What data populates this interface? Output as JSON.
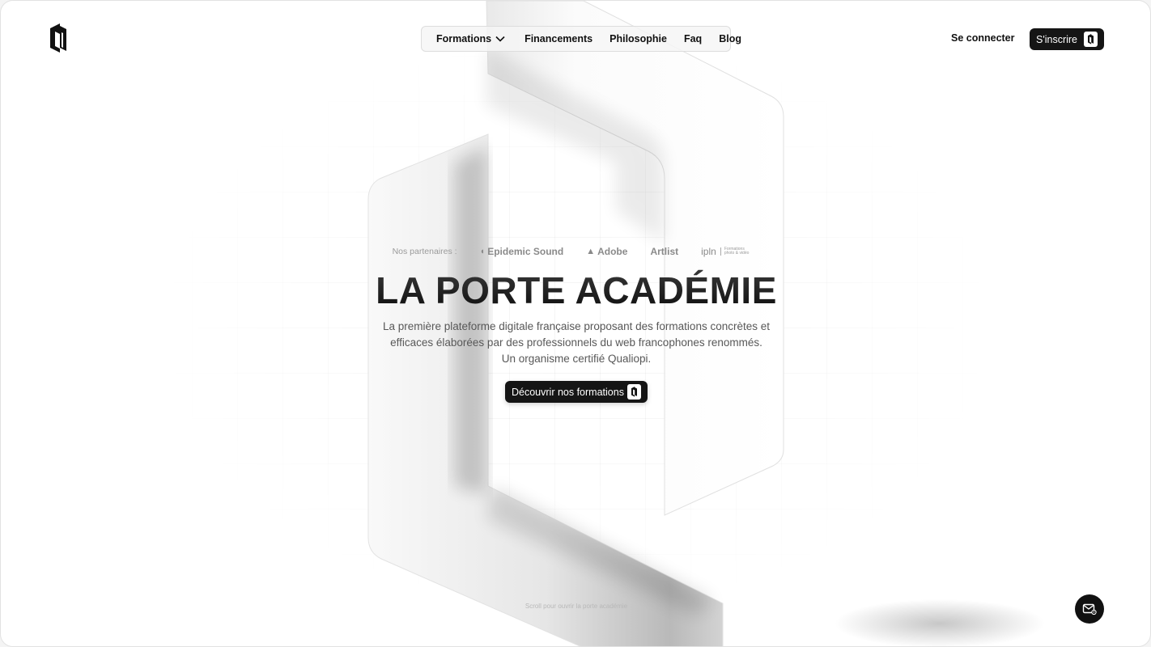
{
  "nav": {
    "items": [
      {
        "label": "Formations",
        "has_dropdown": true
      },
      {
        "label": "Financements"
      },
      {
        "label": "Philosophie"
      },
      {
        "label": "Faq"
      },
      {
        "label": "Blog"
      }
    ]
  },
  "auth": {
    "login_label": "Se connecter",
    "signup_label": "S'inscrire"
  },
  "hero": {
    "partners_label": "Nos partenaires :",
    "partners": [
      "Epidemic Sound",
      "Adobe",
      "Artlist",
      "ipln"
    ],
    "partners_extra": [
      "Formations",
      "photo & vidéo"
    ],
    "title": "LA PORTE ACADÉMIE",
    "subtitle_lines": [
      "La première plateforme digitale française proposant des formations concrètes et",
      "efficaces élaborées par des professionnels du web francophones renommés.",
      "Un organisme certifié Qualiopi."
    ],
    "cta_label": "Découvrir nos formations",
    "scroll_hint": "Scroll pour ouvrir la porte académie"
  },
  "icons": {
    "logo": "la-porte-logo",
    "dropdown": "chevron-down-icon",
    "badge": "la-porte-badge-icon",
    "mail": "mail-icon"
  },
  "colors": {
    "primary_dark": "#151515",
    "text": "#111111",
    "muted": "#585858",
    "background": "#ffffff"
  }
}
